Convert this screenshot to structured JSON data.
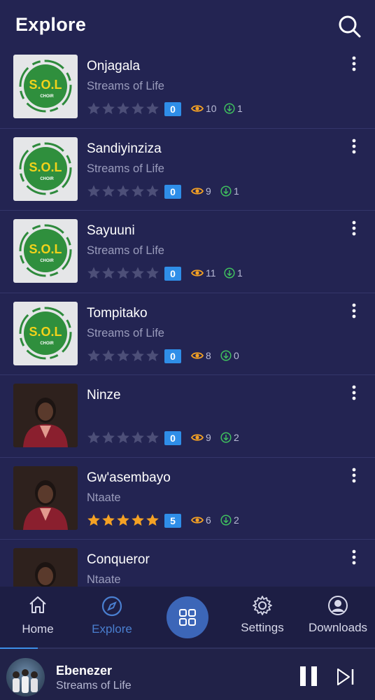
{
  "header": {
    "title": "Explore",
    "search_icon": "search-icon"
  },
  "rows": [
    {
      "name": "Onjagala",
      "artist": "Streams of Life",
      "thumb": "sol",
      "rating": 0,
      "rating_label": "0",
      "views": "10",
      "downloads": "1"
    },
    {
      "name": "Sandiyinziza",
      "artist": "Streams of Life",
      "thumb": "sol",
      "rating": 0,
      "rating_label": "0",
      "views": "9",
      "downloads": "1"
    },
    {
      "name": "Sayuuni",
      "artist": "Streams of Life",
      "thumb": "sol",
      "rating": 0,
      "rating_label": "0",
      "views": "11",
      "downloads": "1"
    },
    {
      "name": "Tompitako",
      "artist": "Streams of Life",
      "thumb": "sol",
      "rating": 0,
      "rating_label": "0",
      "views": "8",
      "downloads": "0"
    },
    {
      "name": "Ninze",
      "artist": "",
      "thumb": "person",
      "rating": 0,
      "rating_label": "0",
      "views": "9",
      "downloads": "2"
    },
    {
      "name": "Gw'asembayo",
      "artist": "Ntaate",
      "thumb": "person",
      "rating": 5,
      "rating_label": "5",
      "views": "6",
      "downloads": "2"
    },
    {
      "name": "Conqueror",
      "artist": "Ntaate",
      "thumb": "person",
      "rating": 0,
      "rating_label": "",
      "views": "",
      "downloads": ""
    }
  ],
  "logo_text": {
    "top": "S.O.L",
    "bottom": "CHOIR"
  },
  "nav": {
    "home": "Home",
    "explore": "Explore",
    "settings": "Settings",
    "downloads": "Downloads"
  },
  "player": {
    "track": "Ebenezer",
    "artist": "Streams of Life",
    "progress": 0.1
  },
  "colors": {
    "background": "#232452",
    "accent": "#3c66b8",
    "star_active": "#f4a124",
    "star_inactive": "#4d4f78",
    "views_icon": "#f4a124",
    "downloads_icon": "#3fbf5e",
    "badge": "#2f8ee8"
  }
}
